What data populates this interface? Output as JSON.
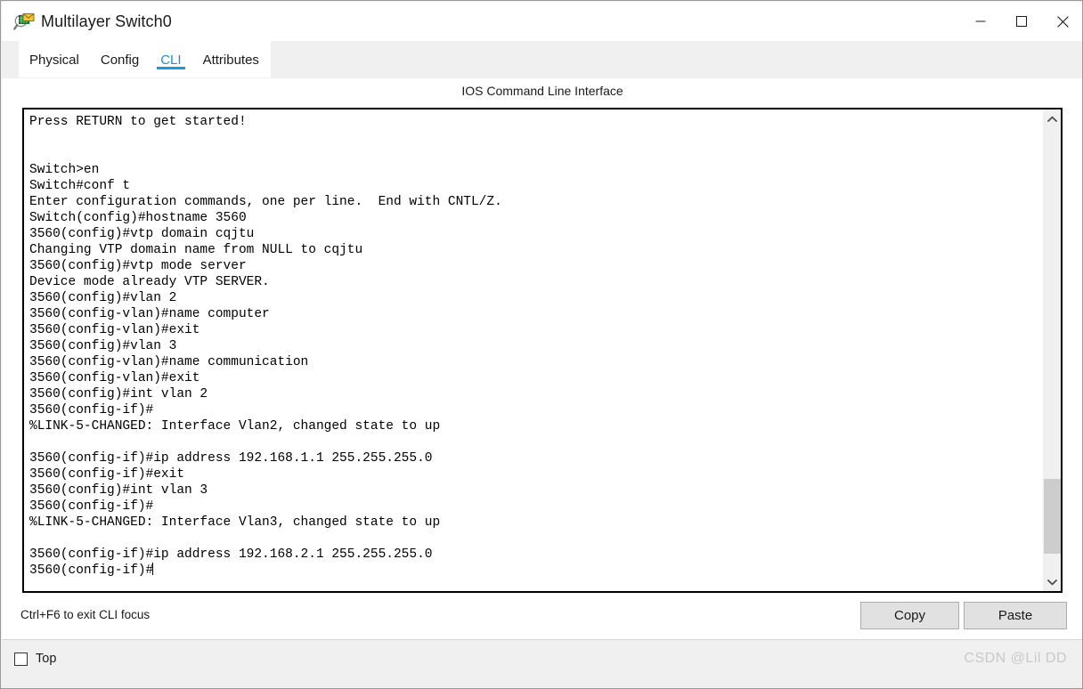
{
  "window": {
    "title": "Multilayer Switch0",
    "icon": "inspect-device-icon",
    "controls": {
      "minimize": "minimize-icon",
      "maximize": "maximize-icon",
      "close": "close-icon"
    }
  },
  "tabs": [
    {
      "label": "Physical",
      "active": false
    },
    {
      "label": "Config",
      "active": false
    },
    {
      "label": "CLI",
      "active": true
    },
    {
      "label": "Attributes",
      "active": false
    }
  ],
  "cli": {
    "heading": "IOS Command Line Interface",
    "focus_hint": "Ctrl+F6 to exit CLI focus",
    "accent_color": "#1a9ada",
    "terminal_text": "Press RETURN to get started!\n\n\nSwitch>en\nSwitch#conf t\nEnter configuration commands, one per line.  End with CNTL/Z.\nSwitch(config)#hostname 3560\n3560(config)#vtp domain cqjtu\nChanging VTP domain name from NULL to cqjtu\n3560(config)#vtp mode server\nDevice mode already VTP SERVER.\n3560(config)#vlan 2\n3560(config-vlan)#name computer\n3560(config-vlan)#exit\n3560(config)#vlan 3\n3560(config-vlan)#name communication\n3560(config-vlan)#exit\n3560(config)#int vlan 2\n3560(config-if)#\n%LINK-5-CHANGED: Interface Vlan2, changed state to up\n\n3560(config-if)#ip address 192.168.1.1 255.255.255.0\n3560(config-if)#exit\n3560(config)#int vlan 3\n3560(config-if)#\n%LINK-5-CHANGED: Interface Vlan3, changed state to up\n\n3560(config-if)#ip address 192.168.2.1 255.255.255.0\n3560(config-if)#",
    "scrollbar": {
      "up_icon": "chevron-up-icon",
      "down_icon": "chevron-down-icon"
    }
  },
  "buttons": {
    "copy": "Copy",
    "paste": "Paste"
  },
  "bottom": {
    "top_checkbox_label": "Top",
    "top_checkbox_checked": false,
    "watermark": "CSDN @Lil DD"
  }
}
